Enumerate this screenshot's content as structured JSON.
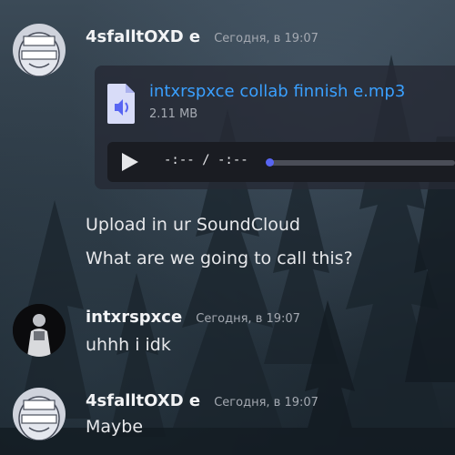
{
  "messages": [
    {
      "author": "4sfalltOXD e",
      "timestamp": "Сегодня, в 19:07",
      "attachment": {
        "file_name": "intxrspxce collab finnish e.mp3",
        "file_size": "2.11 MB",
        "player_time": "-:-- / -:--",
        "progress": 0
      },
      "lines": [
        "Upload in ur SoundCloud",
        "What are we going to call this?"
      ]
    },
    {
      "author": "intxrspxce",
      "timestamp": "Сегодня, в 19:07",
      "lines": [
        "uhhh i idk"
      ]
    },
    {
      "author": "4sfalltOXD e",
      "timestamp": "Сегодня, в 19:07",
      "lines": [
        "Maybe"
      ]
    }
  ],
  "colors": {
    "link": "#3aa0ff",
    "accent": "#5865f2",
    "text": "#e6e7ea",
    "muted": "#a4a9b1"
  },
  "icons": {
    "audio_file": "audio-file-icon",
    "play": "play-icon"
  }
}
